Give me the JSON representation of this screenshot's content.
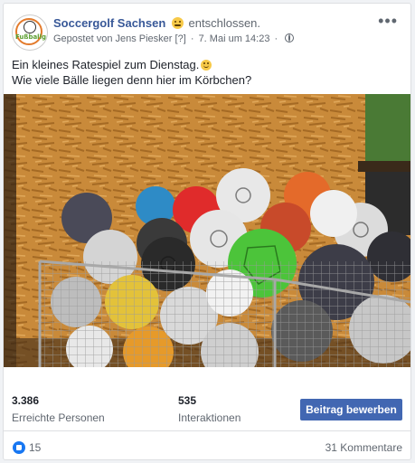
{
  "post": {
    "page_name": "Soccergolf Sachsen",
    "feeling": "entschlossen.",
    "posted_by": "Gepostet von Jens Piesker",
    "posted_by_badge": "[?]",
    "separator": "·",
    "date": "7. Mai um 14:23",
    "line1": "Ein kleines Ratespiel zum Dienstag.",
    "line2": "Wie viele Bälle liegen denn hier im Körbchen?",
    "more_label": "•••"
  },
  "stats": {
    "reach_value": "3.386",
    "reach_label": "Erreichte Personen",
    "interactions_value": "535",
    "interactions_label": "Interaktionen",
    "promote_label": "Beitrag bewerben"
  },
  "footer": {
    "likes": "15",
    "comments": "31 Kommentare"
  },
  "logo_text": "Fußballgolf",
  "colors": {
    "link": "#385898",
    "button": "#4267b2",
    "like": "#1877f2"
  }
}
